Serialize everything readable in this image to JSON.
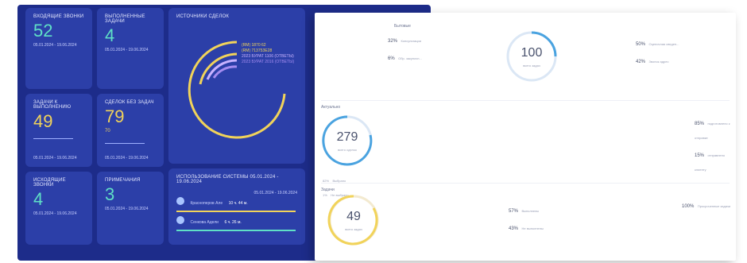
{
  "colors": {
    "dashboard_bg": "#1d2c8a",
    "card_bg": "#2c3fa8",
    "accent_teal": "#5fe0c6",
    "accent_yellow": "#f1d35a",
    "ring_blue": "#4aa3e0",
    "ring_yellow": "#f1d35a"
  },
  "dashboard": {
    "incoming_calls": {
      "title": "входящие звонки",
      "value": "52",
      "date": "05.01.2024 - 19.06.2024"
    },
    "completed_tasks": {
      "title": "выполненные задачи",
      "value": "4",
      "date": "05.01.2024 - 19.06.2024"
    },
    "deal_sources": {
      "title": "источники сделок",
      "legend": [
        "(RM) 1870 62",
        "(RM) 71375ЗЕ28",
        "2023 БУРАТ 1106 (ОТВЕТЫ)",
        "2023 БУРАТ 2016 (ОТВЕТЫ)"
      ]
    },
    "tasks_to_do": {
      "title": "задачи к выполнению",
      "value": "49",
      "date": "05.01.2024 - 19.06.2024"
    },
    "deals_no_tasks": {
      "title": "сделок без задач",
      "value": "79",
      "sub": "70",
      "date": "05.01.2024 - 19.06.2024"
    },
    "outgoing_calls": {
      "title": "исходящие звонки",
      "value": "4",
      "date": "05.01.2024 - 19.06.2024"
    },
    "notes": {
      "title": "примечания",
      "value": "3",
      "date": "05.01.2024 - 19.06.2024"
    },
    "system_usage": {
      "title": "использование системы 05.01.2024 - 19.06.2024",
      "date": "05.01.2024 - 19.06.2024",
      "users": [
        {
          "name": "Красноперов Але",
          "time": "10 ч. 44 м."
        },
        {
          "name": "Сенкова Адели",
          "time": "6 ч. 26 м."
        }
      ]
    }
  },
  "panel": {
    "top": {
      "label_left": "Бытовые",
      "left_rows": [
        {
          "pct": "32%",
          "text": "Консультации"
        },
        {
          "pct": "6%",
          "text": "Обр. закупочн..."
        }
      ],
      "ring_value": "100",
      "ring_caption": "всего задач",
      "right_rows": [
        {
          "pct": "50%",
          "text": "Оценочная сведен..."
        },
        {
          "pct": "42%",
          "text": "Звонок адрес"
        }
      ]
    },
    "middle": {
      "label": "Актуально",
      "ring_value": "279",
      "ring_caption": "всего сделок",
      "bottom_rows": [
        {
          "pct": "82%",
          "text": "Выбрано"
        },
        {
          "pct": "1%",
          "text": "Не выбрано"
        }
      ],
      "right_rows": [
        {
          "pct": "85%",
          "text": "подготовлено к отправке"
        },
        {
          "pct": "15%",
          "text": "отправлено клиенту"
        }
      ]
    },
    "bottom": {
      "label": "Задачи",
      "ring_value": "49",
      "ring_caption": "всего задач",
      "mid_rows": [
        {
          "pct": "57%",
          "text": "Выполнены"
        },
        {
          "pct": "43%",
          "text": "Не выполнены"
        }
      ],
      "right_rows": [
        {
          "pct": "100%",
          "text": "Просроченные задачи"
        }
      ]
    }
  }
}
